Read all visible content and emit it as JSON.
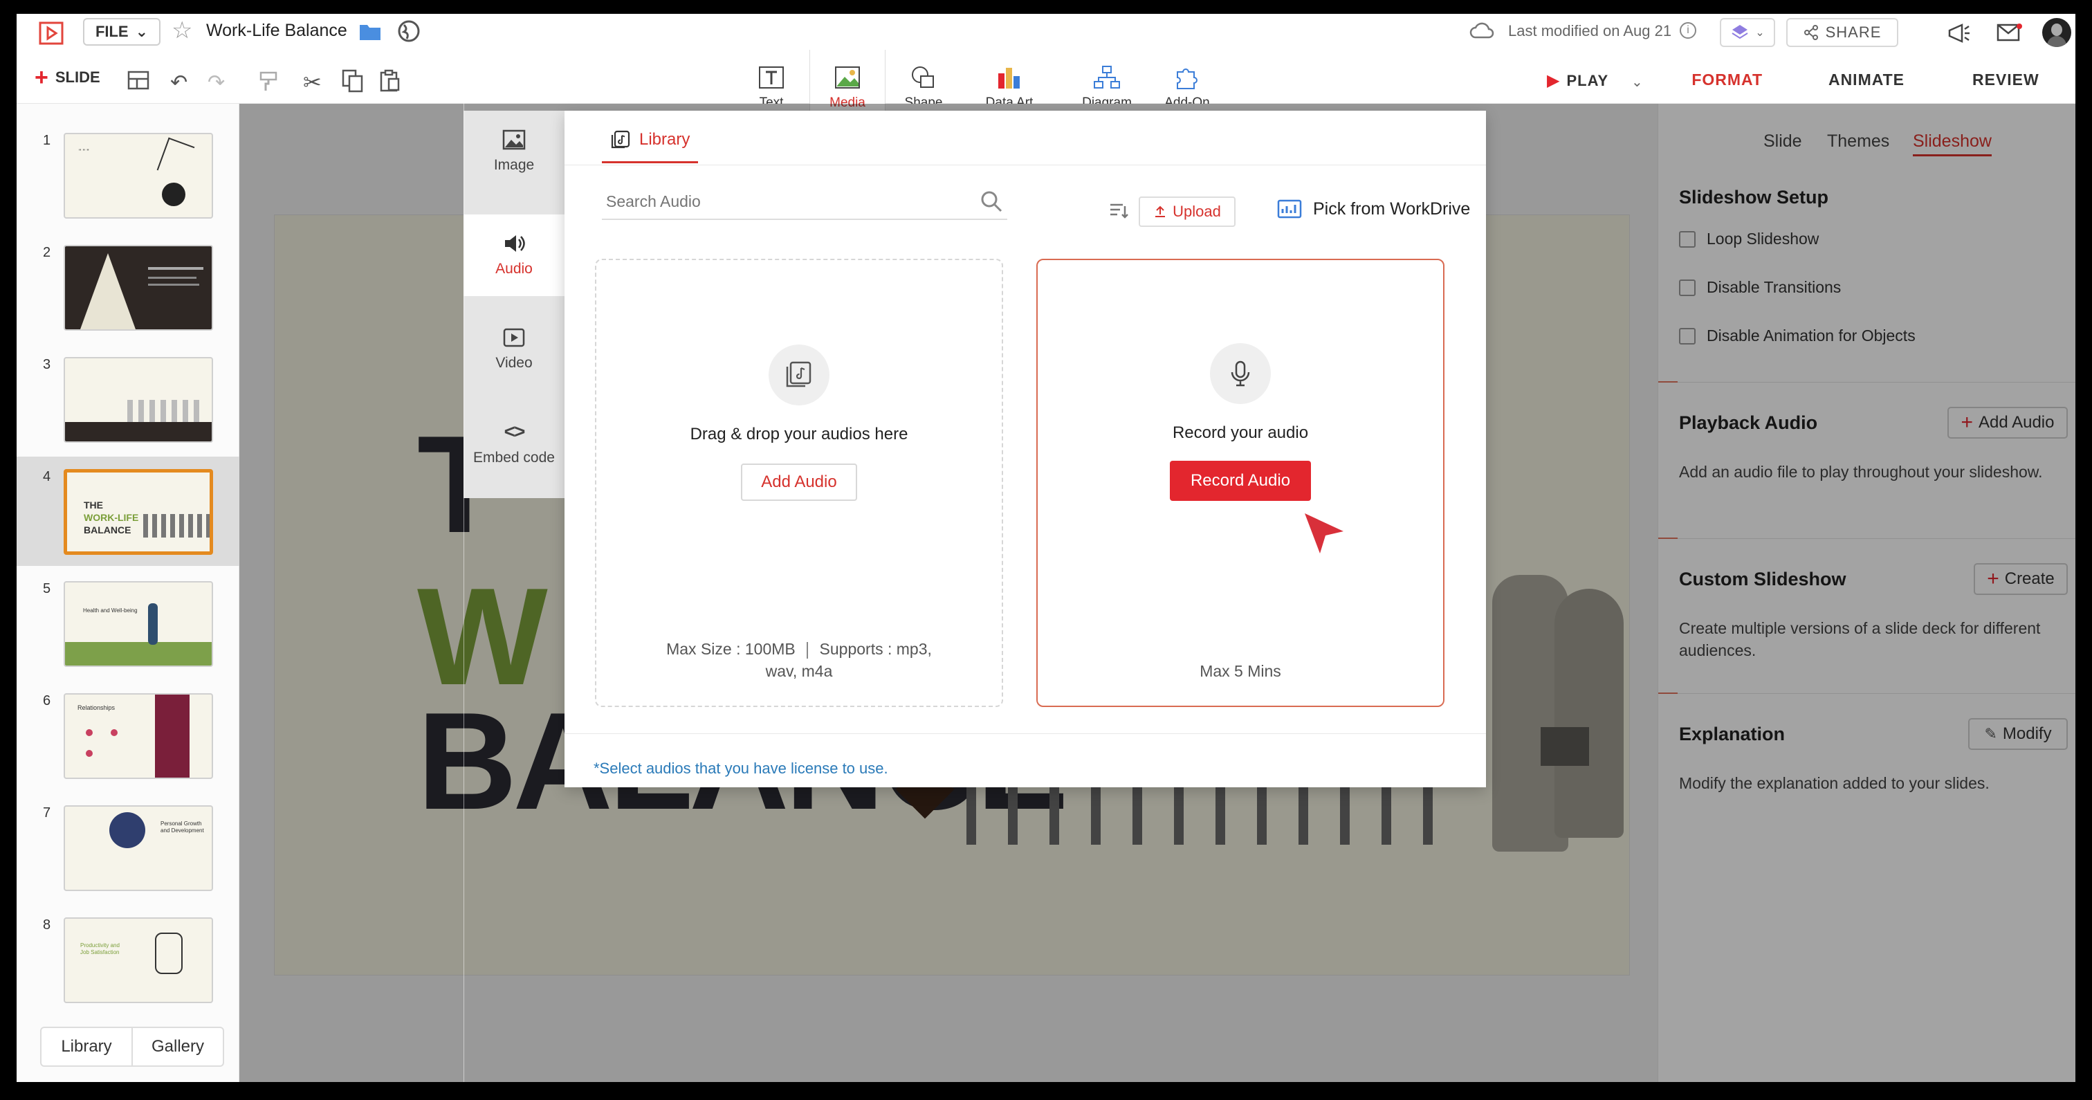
{
  "app": {
    "doc_title": "Work-Life Balance",
    "file_label": "FILE",
    "last_modified": "Last modified on Aug 21",
    "share_label": "SHARE"
  },
  "toolbar": {
    "slide_label": "SLIDE",
    "play_label": "PLAY",
    "tools": [
      {
        "label": "Text",
        "icon": "text-icon"
      },
      {
        "label": "Media",
        "icon": "image-icon"
      },
      {
        "label": "Shape",
        "icon": "shape-icon"
      },
      {
        "label": "Data Art",
        "icon": "chart-icon"
      },
      {
        "label": "Diagram",
        "icon": "diagram-icon"
      },
      {
        "label": "Add-On",
        "icon": "puzzle-icon"
      }
    ]
  },
  "right_tabs": [
    "FORMAT",
    "ANIMATE",
    "REVIEW"
  ],
  "right_subtabs": [
    "Slide",
    "Themes",
    "Slideshow"
  ],
  "right_panel": {
    "setup_title": "Slideshow Setup",
    "checkboxes": [
      "Loop Slideshow",
      "Disable Transitions",
      "Disable Animation for Objects"
    ],
    "playback_title": "Playback Audio",
    "playback_button": "Add Audio",
    "playback_desc": "Add an audio file to play throughout your slideshow.",
    "custom_title": "Custom Slideshow",
    "custom_button": "Create",
    "custom_desc": "Create multiple versions of a slide deck for different audiences.",
    "explanation_title": "Explanation",
    "explanation_button": "Modify",
    "explanation_desc": "Modify the explanation added to your slides."
  },
  "slides": {
    "numbers": [
      "1",
      "2",
      "3",
      "4",
      "5",
      "6",
      "7",
      "8"
    ],
    "selected": "4",
    "thumb4": {
      "line1": "THE",
      "line2": "WORK-LIFE",
      "line3": "BALANCE"
    },
    "thumb5": "Health and Well-being",
    "thumb6": "Relationships",
    "thumb7": "Personal Growth and Development",
    "thumb8": "Productivity and Job Satisfaction"
  },
  "slide_canvas": {
    "text_t": "T",
    "text_w": "W",
    "text_b": "BALANCE"
  },
  "media_side": [
    {
      "label": "Image",
      "icon": "image-icon"
    },
    {
      "label": "Audio",
      "icon": "speaker-icon"
    },
    {
      "label": "Video",
      "icon": "video-icon"
    },
    {
      "label": "Embed code",
      "icon": "code-icon"
    }
  ],
  "modal": {
    "tab_label": "Library",
    "search_placeholder": "Search Audio",
    "upload_label": "Upload",
    "pick_label": "Pick from WorkDrive",
    "drop_title": "Drag & drop your audios here",
    "drop_button": "Add Audio",
    "drop_footer_1": "Max Size : 100MB",
    "drop_footer_2": "Supports : mp3,",
    "drop_footer_3": "wav, m4a",
    "rec_title": "Record your audio",
    "rec_button": "Record Audio",
    "rec_footer": "Max 5 Mins",
    "license_note": "*Select audios that you have license to use."
  },
  "bottom_tabs": [
    "Library",
    "Gallery"
  ],
  "colors": {
    "accent": "#d6322d",
    "record": "#e3262e",
    "link": "#2a7ab8"
  }
}
